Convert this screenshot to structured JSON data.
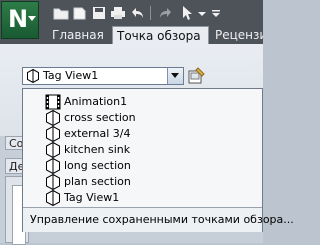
{
  "app": {
    "logo_letter": "N",
    "icon": "app-menu-icon"
  },
  "quick_access": [
    {
      "name": "folder-icon"
    },
    {
      "name": "new-doc-icon"
    },
    {
      "name": "save-icon"
    },
    {
      "name": "print-icon"
    },
    {
      "name": "undo-icon"
    },
    {
      "name": "redo-icon"
    },
    {
      "name": "select-cursor-icon"
    },
    {
      "name": "customize-icon"
    }
  ],
  "tabs": [
    {
      "label": "Главная",
      "active": false
    },
    {
      "label": "Точка обзора",
      "active": true
    },
    {
      "label": "Рецензи",
      "active": false
    }
  ],
  "viewpoint_combo": {
    "value": "Tag View1",
    "icon": "viewpoint-icon"
  },
  "save_viewpoint_button": {
    "icon": "save-viewpoint-icon"
  },
  "side_panel": {
    "tab1_label": "Со",
    "tab2_label": "Де"
  },
  "dropdown": {
    "items": [
      {
        "label": "Animation1",
        "icon": "animation-icon"
      },
      {
        "label": "cross section",
        "icon": "viewpoint-icon"
      },
      {
        "label": "external 3/4",
        "icon": "viewpoint-icon"
      },
      {
        "label": "kitchen sink",
        "icon": "viewpoint-icon"
      },
      {
        "label": "long section",
        "icon": "viewpoint-icon"
      },
      {
        "label": "plan section",
        "icon": "viewpoint-icon"
      },
      {
        "label": "Tag View1",
        "icon": "viewpoint-icon"
      }
    ],
    "manage_label": "Управление сохраненными точками обзора..."
  },
  "colors": {
    "title_bar": "#4e5259",
    "ribbon": "#e9edf2",
    "app_green": "#2d7c48"
  }
}
